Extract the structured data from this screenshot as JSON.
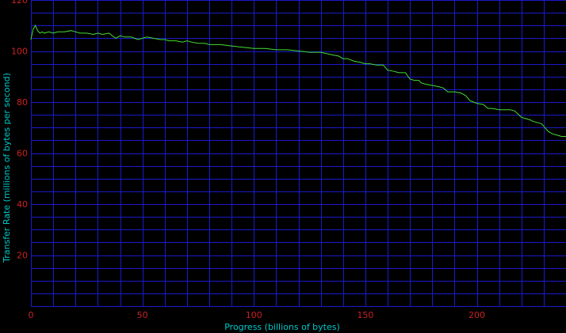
{
  "chart_data": {
    "type": "line",
    "xlabel": "Progress (billions of bytes)",
    "ylabel": "Transfer Rate (millions of bytes per second)",
    "xlim": [
      0,
      240
    ],
    "ylim": [
      0,
      120
    ],
    "x_ticks": [
      0,
      50,
      100,
      150,
      200
    ],
    "y_ticks": [
      20,
      40,
      60,
      80,
      100,
      120
    ],
    "x_tick_labels": [
      "0",
      "50",
      "100",
      "150",
      "200"
    ],
    "y_tick_labels": [
      "20",
      "40",
      "60",
      "80",
      "100",
      "120"
    ],
    "x_minor_step": 10,
    "y_minor_step": 5,
    "grid": true,
    "colors": {
      "background": "#000000",
      "grid": "#1a1acc",
      "line": "#44dd33",
      "tick_labels": "#cc2222",
      "axis_titles": "#00c8c8"
    },
    "series": [
      {
        "x": [
          0,
          1,
          2,
          3,
          4,
          5,
          6,
          8,
          10,
          12,
          15,
          18,
          20,
          22,
          25,
          28,
          30,
          32,
          35,
          38,
          40,
          42,
          45,
          48,
          50,
          52,
          55,
          58,
          60,
          62,
          65,
          68,
          70,
          72,
          75,
          78,
          80,
          85,
          90,
          95,
          100,
          105,
          110,
          115,
          120,
          125,
          130,
          135,
          138,
          140,
          142,
          145,
          148,
          150,
          152,
          155,
          158,
          160,
          163,
          165,
          168,
          170,
          172,
          174,
          175,
          177,
          180,
          183,
          185,
          187,
          190,
          193,
          195,
          197,
          200,
          203,
          205,
          207,
          210,
          213,
          215,
          217,
          220,
          222,
          224,
          225,
          227,
          229,
          230,
          232,
          234,
          236,
          238,
          240
        ],
        "y": [
          104.5,
          108.5,
          110,
          108,
          107,
          107.5,
          107,
          107.5,
          107,
          107.5,
          107.5,
          108,
          107.5,
          107,
          107,
          106.5,
          107,
          106.5,
          107,
          105,
          106,
          105.5,
          105.5,
          104.5,
          105,
          105.5,
          105,
          104.5,
          104.5,
          104,
          104,
          103.5,
          104,
          103.5,
          103,
          103,
          102.5,
          102.5,
          102,
          101.5,
          101,
          101,
          100.5,
          100.5,
          100,
          99.5,
          99.5,
          98.5,
          98,
          97,
          97,
          96,
          95.5,
          95,
          95,
          94.5,
          94.5,
          92.5,
          92,
          91.5,
          91.5,
          89,
          88.5,
          88.5,
          87.5,
          87,
          86.5,
          86,
          85.5,
          84,
          84,
          83.5,
          82.5,
          80.5,
          79.5,
          79,
          77.5,
          77.5,
          77,
          77,
          77,
          76.5,
          74,
          73.5,
          73,
          72.5,
          72,
          71.5,
          70.5,
          68.5,
          67.5,
          67,
          66.5,
          66.5
        ]
      }
    ]
  }
}
